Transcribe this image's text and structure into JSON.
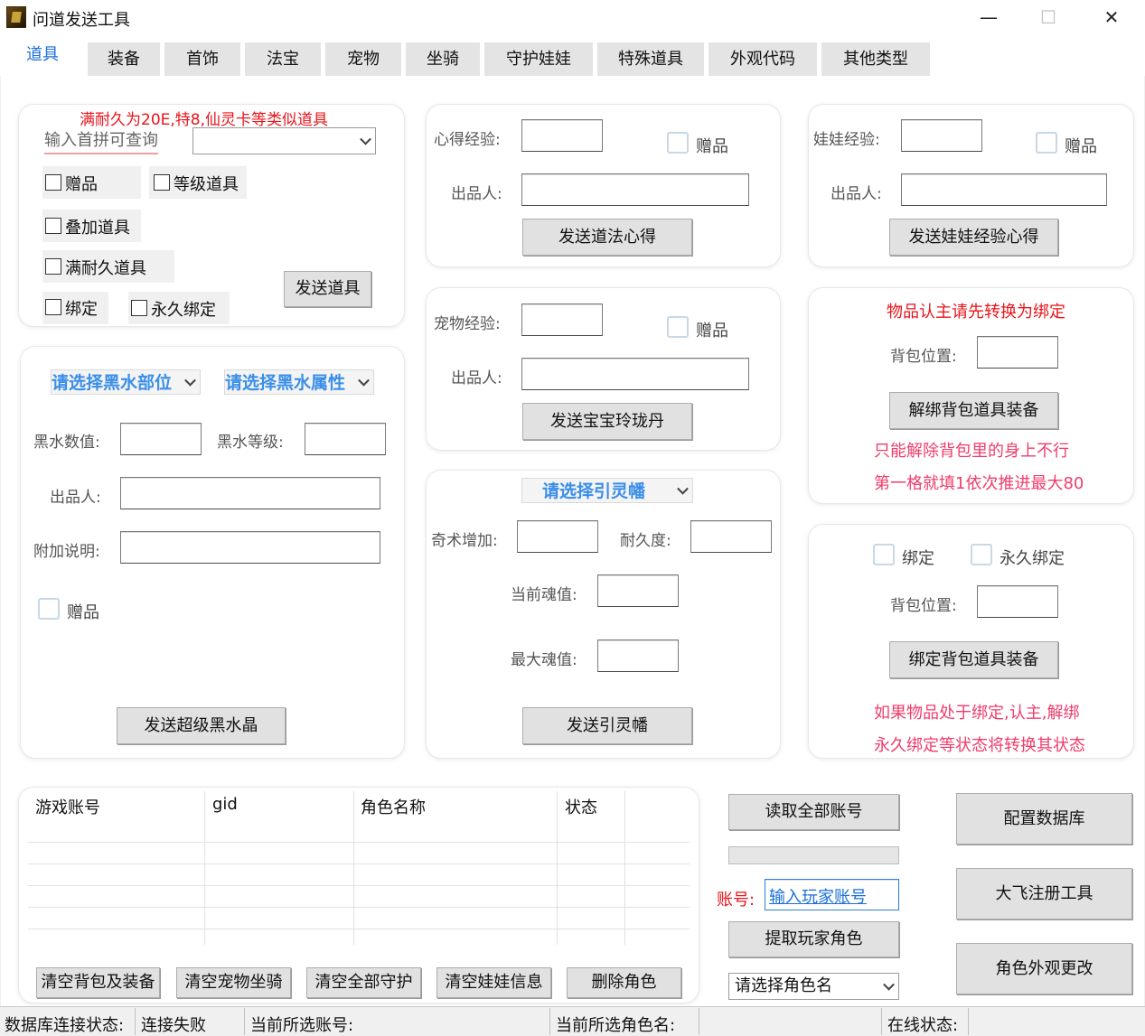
{
  "window": {
    "title": "问道发送工具",
    "minimize": "—",
    "maximize": "☐",
    "close": "✕"
  },
  "tabs": [
    "道具",
    "装备",
    "首饰",
    "法宝",
    "宠物",
    "坐骑",
    "守护娃娃",
    "特殊道具",
    "外观代码",
    "其他类型"
  ],
  "item_panel": {
    "notice": "满耐久为20E,特8,仙灵卡等类似道具",
    "search_label": "输入首拼可查询",
    "search_value": "",
    "cb_gift": "赠品",
    "cb_level_item": "等级道具",
    "cb_stack_item": "叠加道具",
    "cb_full_durability": "满耐久道具",
    "cb_bind": "绑定",
    "cb_perm_bind": "永久绑定",
    "send_button": "发送道具"
  },
  "blackwater_panel": {
    "select_part": "请选择黑水部位",
    "select_attr": "请选择黑水属性",
    "value_label": "黑水数值:",
    "level_label": "黑水等级:",
    "maker_label": "出品人:",
    "note_label": "附加说明:",
    "gift_label": "赠品",
    "send_button": "发送超级黑水晶"
  },
  "xinde_panel": {
    "exp_label": "心得经验:",
    "gift_label": "赠品",
    "maker_label": "出品人:",
    "send_button": "发送道法心得"
  },
  "pet_panel": {
    "exp_label": "宠物经验:",
    "gift_label": "赠品",
    "maker_label": "出品人:",
    "send_button": "发送宝宝玲珑丹"
  },
  "soul_panel": {
    "select_label": "请选择引灵幡",
    "qishu_label": "奇术增加:",
    "durability_label": "耐久度:",
    "cur_soul_label": "当前魂值:",
    "max_soul_label": "最大魂值:",
    "send_button": "发送引灵幡"
  },
  "doll_panel": {
    "exp_label": "娃娃经验:",
    "gift_label": "赠品",
    "maker_label": "出品人:",
    "send_button": "发送娃娃经验心得"
  },
  "unbind_panel": {
    "notice": "物品认主请先转换为绑定",
    "bag_label": "背包位置:",
    "button": "解绑背包道具装备",
    "tip1": "只能解除背包里的身上不行",
    "tip2": "第一格就填1依次推进最大80"
  },
  "bind_panel": {
    "cb_bind": "绑定",
    "cb_perm_bind": "永久绑定",
    "bag_label": "背包位置:",
    "button": "绑定背包道具装备",
    "tip1": "如果物品处于绑定,认主,解绑",
    "tip2": "永久绑定等状态将转换其状态"
  },
  "account_table": {
    "columns": [
      "游戏账号",
      "gid",
      "角色名称",
      "状态"
    ],
    "buttons": [
      "清空背包及装备",
      "清空宠物坐骑",
      "清空全部守护",
      "清空娃娃信息",
      "删除角色"
    ]
  },
  "account_ops": {
    "read_all": "读取全部账号",
    "account_label": "账号:",
    "account_input": "输入玩家账号",
    "fetch_roles": "提取玩家角色",
    "role_select": "请选择角色名"
  },
  "right_buttons": [
    "配置数据库",
    "大飞注册工具",
    "角色外观更改"
  ],
  "statusbar": {
    "db_label": "数据库连接状态:",
    "db_value": "连接失败",
    "account_label": "当前所选账号:",
    "role_label": "当前所选角色名:",
    "online_label": "在线状态:"
  },
  "colors": {
    "accent": "#1a6fd8",
    "notice_red": "#e8141a",
    "tip_pink": "#f03c6a",
    "select_blue": "#3a8ee8"
  }
}
